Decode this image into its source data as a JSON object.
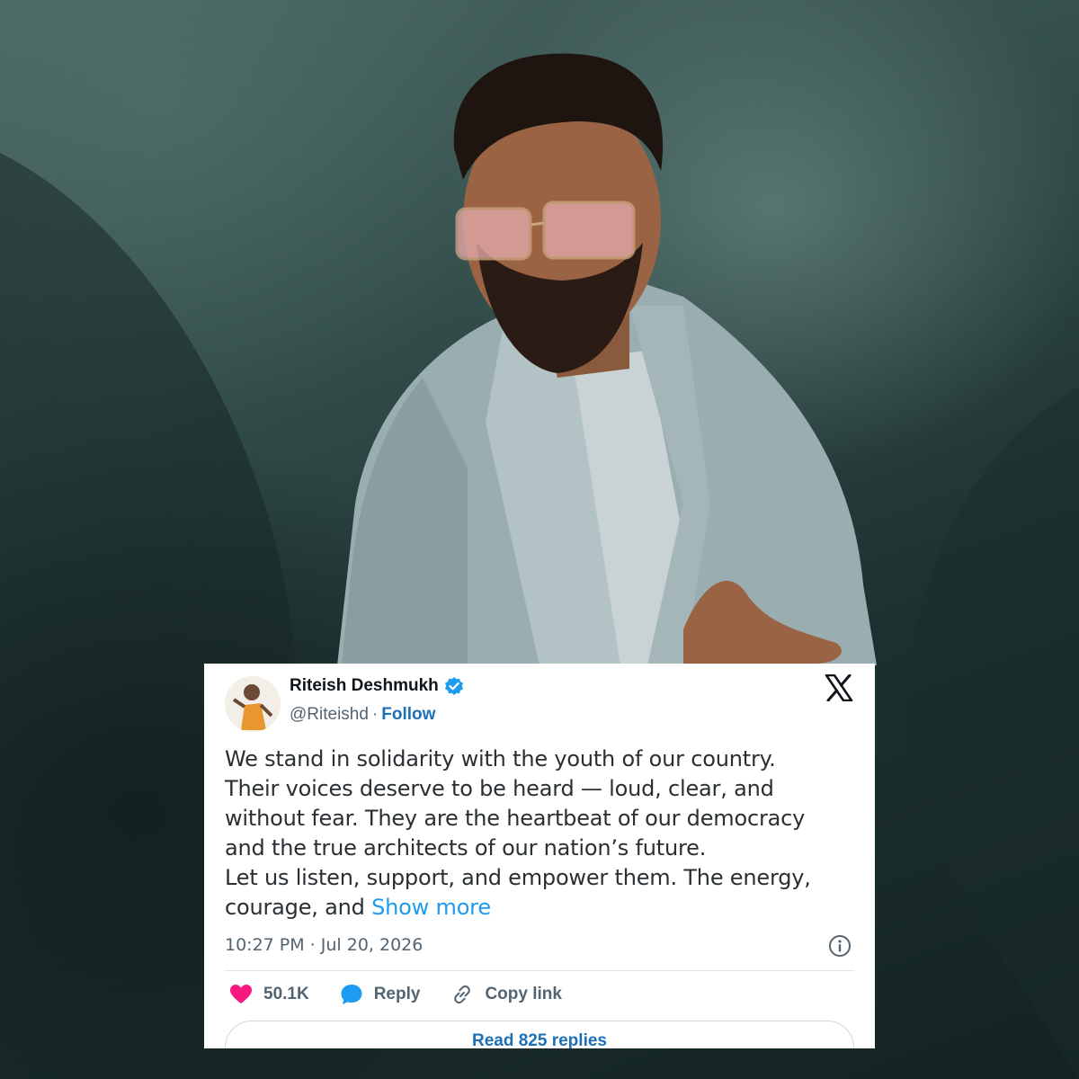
{
  "tweet": {
    "author_name": "Riteish Deshmukh",
    "handle": "@Riteishd",
    "separator": "·",
    "follow_label": "Follow",
    "verified": true,
    "text_lines": [
      "We stand in solidarity with the youth of our country.",
      "Their voices deserve to be heard — loud, clear, and",
      "without fear. They are the heartbeat of our democracy",
      "and the true architects of our nation’s future.",
      "Let us listen, support, and empower them. The energy,",
      "courage, and"
    ],
    "show_more_label": "Show more",
    "timestamp": "10:27 PM · Jul 20, 2026",
    "likes_count": "50.1K",
    "reply_label": "Reply",
    "copy_link_label": "Copy link",
    "read_replies_label": "Read 825 replies"
  },
  "icons": {
    "verified": "verified-badge-icon",
    "brand": "x-logo-icon",
    "info": "info-icon",
    "like": "heart-icon",
    "reply": "speech-bubble-icon",
    "link": "link-icon"
  },
  "colors": {
    "card_bg": "#ffffff",
    "primary_text": "#0f1419",
    "secondary_text": "#536471",
    "link_blue": "#1d9bf0",
    "follow_blue": "#1d6fb8",
    "heart_pink": "#f91880",
    "verified_blue": "#1d9bf0",
    "backdrop": "#2f4a47"
  }
}
